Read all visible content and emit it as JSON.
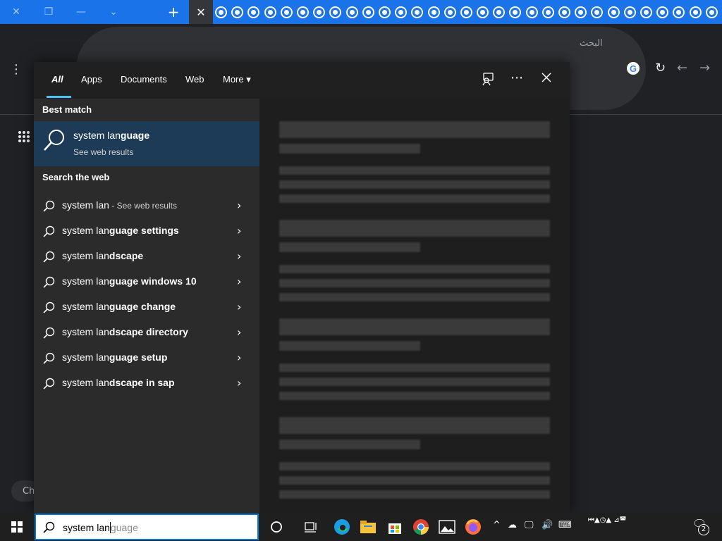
{
  "browser": {
    "tab_close_glyph": "✕",
    "new_tab_glyph": "+",
    "search_placeholder": "البحث",
    "google_g": "G",
    "chip_text": "Ch"
  },
  "start_search": {
    "tabs": [
      {
        "label": "All",
        "active": true
      },
      {
        "label": "Apps"
      },
      {
        "label": "Documents"
      },
      {
        "label": "Web"
      },
      {
        "label": "More"
      }
    ],
    "more_caret": "▾",
    "best_match": {
      "heading": "Best match",
      "title_prefix": "system lan",
      "title_bold": "guage",
      "subtitle": "See web results"
    },
    "web_heading": "Search the web",
    "web_results": [
      {
        "prefix": "system lan",
        "bold": "",
        "suffix": " - See web results"
      },
      {
        "prefix": "system lan",
        "bold": "guage settings",
        "suffix": ""
      },
      {
        "prefix": "system lan",
        "bold": "dscape",
        "suffix": ""
      },
      {
        "prefix": "system lan",
        "bold": "guage windows 10",
        "suffix": ""
      },
      {
        "prefix": "system lan",
        "bold": "guage change",
        "suffix": ""
      },
      {
        "prefix": "system lan",
        "bold": "dscape directory",
        "suffix": ""
      },
      {
        "prefix": "system lan",
        "bold": "guage setup",
        "suffix": ""
      },
      {
        "prefix": "system lan",
        "bold": "dscape in sap",
        "suffix": ""
      }
    ]
  },
  "taskbar": {
    "search_typed": "system lan",
    "search_suggest": "guage",
    "notification_count": "2",
    "keyboard_text": "⏮▲◷▲ ⊿◚"
  },
  "colors": {
    "accent": "#0078d7",
    "selection": "#1d3b56",
    "tab_underline": "#4cc2ff",
    "browser_tabstrip": "#1a73e8"
  }
}
